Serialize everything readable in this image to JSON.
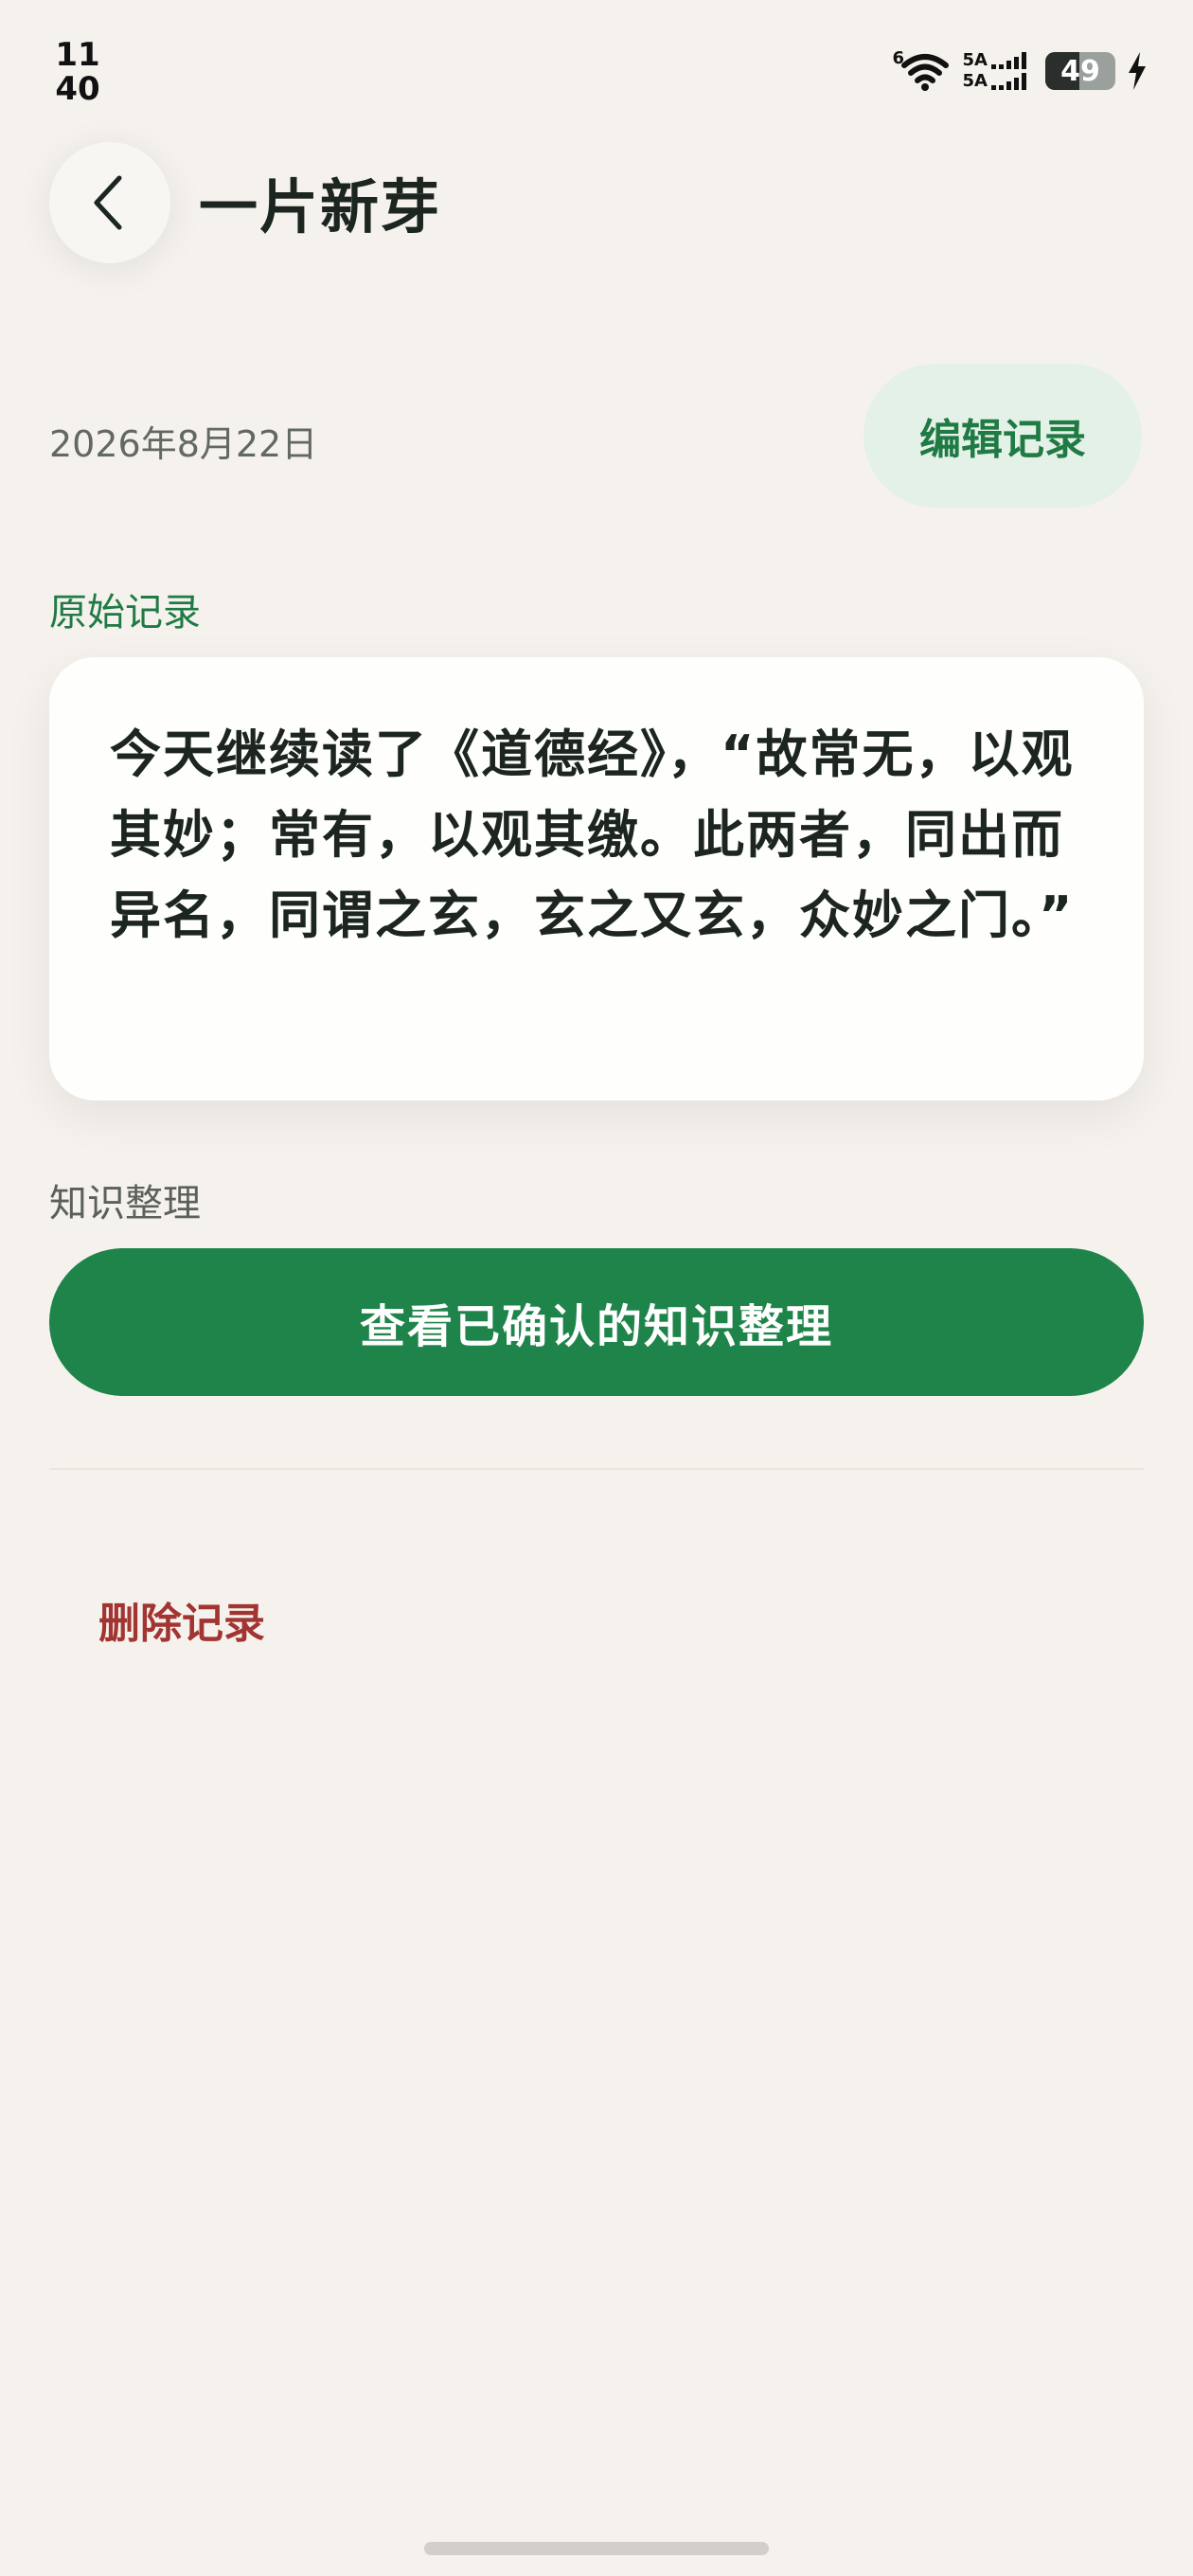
{
  "status_bar": {
    "time_hour": "11",
    "time_minute": "40",
    "wifi_badge": "6",
    "signal_1_label": "5A",
    "signal_2_label": "5A",
    "battery_level": "49"
  },
  "header": {
    "title": "一片新芽"
  },
  "record": {
    "date": "2026年8月22日",
    "edit_label": "编辑记录",
    "original_label": "原始记录",
    "text": "今天继续读了《道德经》，“故常无，以观其妙；常有，以观其缴。此两者，同出而异名，同谓之玄，玄之又玄，众妙之门。”"
  },
  "knowledge": {
    "label": "知识整理",
    "button_label": "查看已确认的知识整理"
  },
  "actions": {
    "delete_label": "删除记录"
  },
  "colors": {
    "background": "#f5f2ed",
    "accent_green": "#1e844a",
    "danger_red": "#a23431",
    "edit_button_bg": "#e3f1e6"
  },
  "icons": {
    "back": "chevron-left-icon",
    "wifi": "wifi-icon",
    "signal": "cellular-signal-icon",
    "battery": "battery-icon",
    "charging": "lightning-bolt-icon"
  }
}
